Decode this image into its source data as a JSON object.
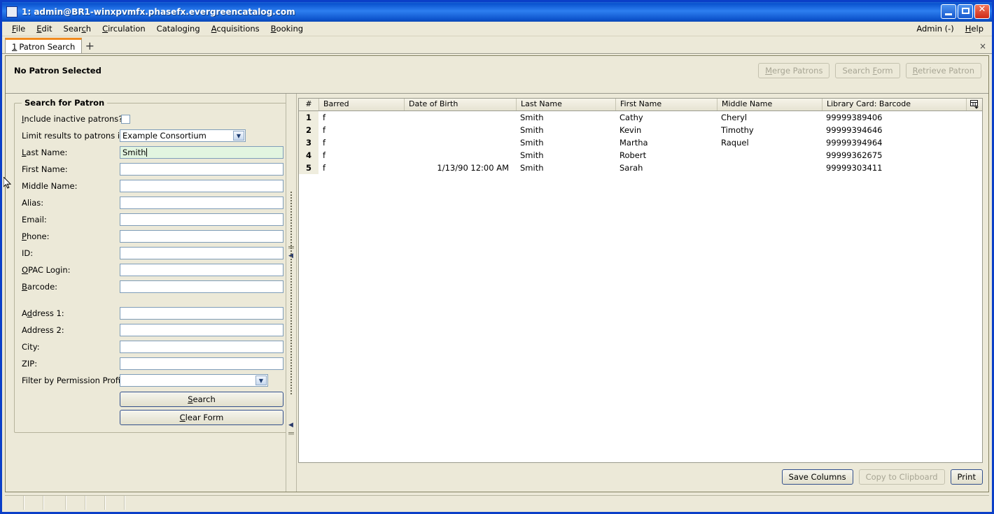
{
  "window": {
    "title": "1: admin@BR1-winxpvmfx.phasefx.evergreencatalog.com",
    "minimize_label": "Minimize",
    "maximize_label": "Maximize",
    "close_label": "Close"
  },
  "menubar": {
    "items": [
      {
        "label": "File",
        "mnemonic": "F"
      },
      {
        "label": "Edit",
        "mnemonic": "E"
      },
      {
        "label": "Search",
        "mnemonic": "c"
      },
      {
        "label": "Circulation",
        "mnemonic": "C"
      },
      {
        "label": "Cataloging",
        "mnemonic": "g"
      },
      {
        "label": "Acquisitions",
        "mnemonic": "A"
      },
      {
        "label": "Booking",
        "mnemonic": "B"
      }
    ],
    "right_items": [
      {
        "label": "Admin (-)",
        "mnemonic": ""
      },
      {
        "label": "Help",
        "mnemonic": "H"
      }
    ]
  },
  "tabs": {
    "items": [
      {
        "number": "1",
        "label": "Patron Search",
        "active": true
      }
    ],
    "new_tab_label": "+",
    "close_label": "×"
  },
  "patron_bar": {
    "title": "No Patron Selected",
    "buttons": [
      {
        "label": "Merge Patrons",
        "enabled": false
      },
      {
        "label": "Search Form",
        "enabled": false
      },
      {
        "label": "Retrieve Patron",
        "enabled": false
      }
    ]
  },
  "search_form": {
    "legend": "Search for Patron",
    "include_inactive_label": "Include inactive patrons?",
    "include_inactive_checked": false,
    "limit_results_label": "Limit results to patrons in",
    "limit_results_value": "Example Consortium",
    "fields": [
      {
        "label": "Last Name:",
        "value": "Smith",
        "placeholder": "",
        "active": true
      },
      {
        "label": "First Name:",
        "value": "",
        "placeholder": "",
        "active": false
      },
      {
        "label": "Middle Name:",
        "value": "",
        "placeholder": "",
        "active": false
      },
      {
        "label": "Alias:",
        "value": "",
        "placeholder": "",
        "active": false
      },
      {
        "label": "Email:",
        "value": "",
        "placeholder": "",
        "active": false
      },
      {
        "label": "Phone:",
        "value": "",
        "placeholder": "",
        "active": false
      },
      {
        "label": "ID:",
        "value": "",
        "placeholder": "",
        "active": false
      },
      {
        "label": "OPAC Login:",
        "value": "",
        "placeholder": "",
        "active": false
      },
      {
        "label": "Barcode:",
        "value": "",
        "placeholder": "",
        "active": false
      }
    ],
    "address_fields": [
      {
        "label": "Address 1:",
        "value": "",
        "placeholder": ""
      },
      {
        "label": "Address 2:",
        "value": "",
        "placeholder": ""
      },
      {
        "label": "City:",
        "value": "",
        "placeholder": ""
      },
      {
        "label": "ZIP:",
        "value": "",
        "placeholder": ""
      }
    ],
    "permission_profile_label": "Filter by Permission Profile:",
    "permission_profile_value": "",
    "search_button": "Search",
    "clear_button": "Clear Form"
  },
  "results": {
    "columns": [
      "#",
      "Barred",
      "Date of Birth",
      "Last Name",
      "First Name",
      "Middle Name",
      "Library Card: Barcode"
    ],
    "column_picker_icon": "columns-picker-icon",
    "rows": [
      {
        "num": "1",
        "barred": "f",
        "dob": "",
        "last": "Smith",
        "first": "Cathy",
        "middle": "Cheryl",
        "card": "99999389406"
      },
      {
        "num": "2",
        "barred": "f",
        "dob": "",
        "last": "Smith",
        "first": "Kevin",
        "middle": "Timothy",
        "card": "99999394646"
      },
      {
        "num": "3",
        "barred": "f",
        "dob": "",
        "last": "Smith",
        "first": "Martha",
        "middle": "Raquel",
        "card": "99999394964"
      },
      {
        "num": "4",
        "barred": "f",
        "dob": "",
        "last": "Smith",
        "first": "Robert",
        "middle": "",
        "card": "99999362675"
      },
      {
        "num": "5",
        "barred": "f",
        "dob": "1/13/90 12:00 AM",
        "last": "Smith",
        "first": "Sarah",
        "middle": "",
        "card": "99999303411"
      }
    ],
    "buttons": [
      {
        "label": "Save Columns",
        "enabled": true
      },
      {
        "label": "Copy to Clipboard",
        "enabled": false
      },
      {
        "label": "Print",
        "enabled": true
      }
    ]
  },
  "colors": {
    "titlebar_blue": "#0a52cf",
    "window_border": "#0b3fc8",
    "chrome_beige": "#ece9d8",
    "active_field_green": "#e2f5e0",
    "tab_accent_orange": "#f08a1e"
  }
}
